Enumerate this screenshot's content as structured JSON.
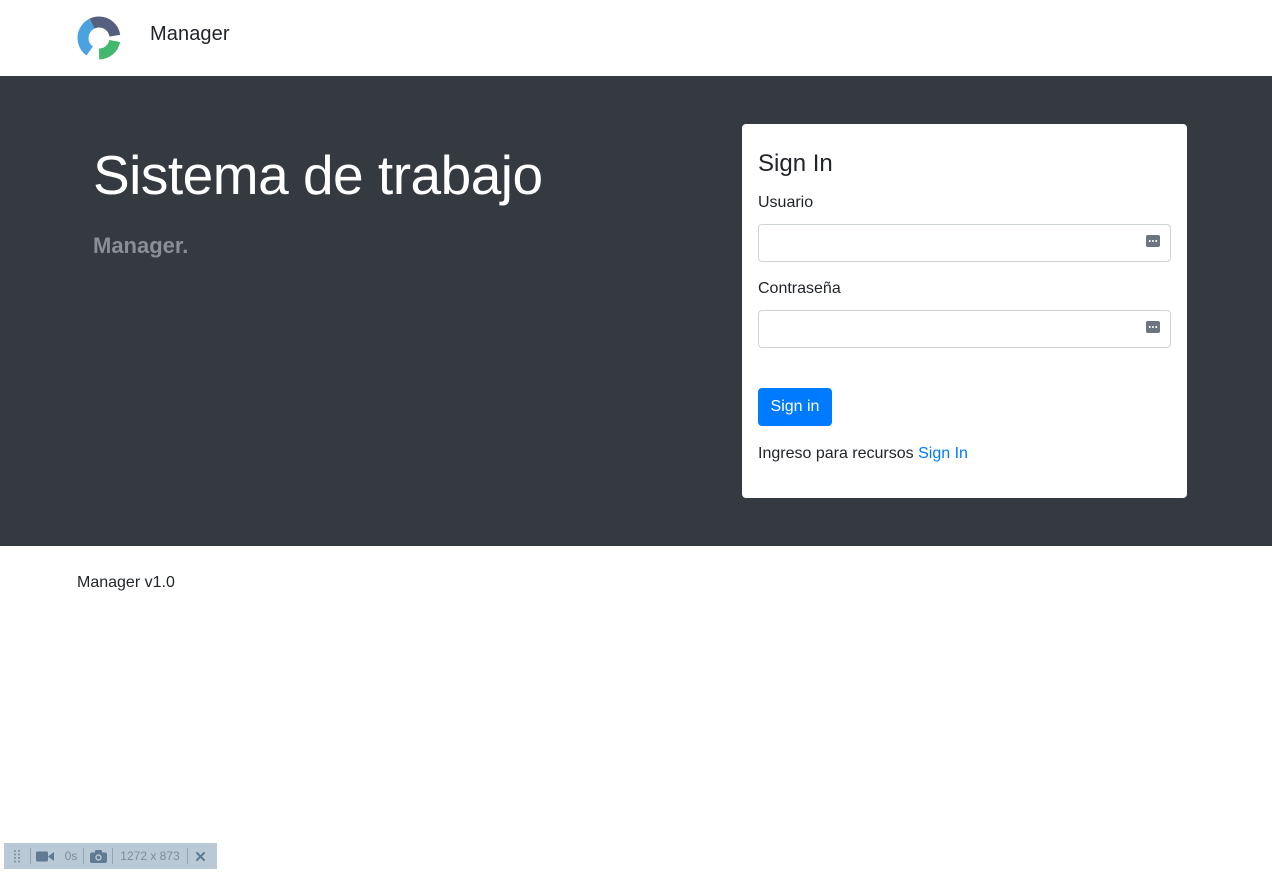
{
  "header": {
    "brand": "Manager",
    "logo_icon": "circular-logo-icon"
  },
  "hero": {
    "title": "Sistema de trabajo",
    "subtitle": "Manager."
  },
  "login": {
    "title": "Sign In",
    "username_label": "Usuario",
    "username_value": "",
    "password_label": "Contraseña",
    "password_value": "",
    "submit_label": "Sign in",
    "footnote_text": "Ingreso para recursos",
    "footnote_link": "Sign In"
  },
  "footer": {
    "text": "Manager v1.0"
  },
  "recorder_toolbar": {
    "duration": "0s",
    "dimensions": "1272 x 873"
  },
  "colors": {
    "hero_bg": "#343a40",
    "primary": "#007bff",
    "subtitle": "#8a8f95"
  }
}
